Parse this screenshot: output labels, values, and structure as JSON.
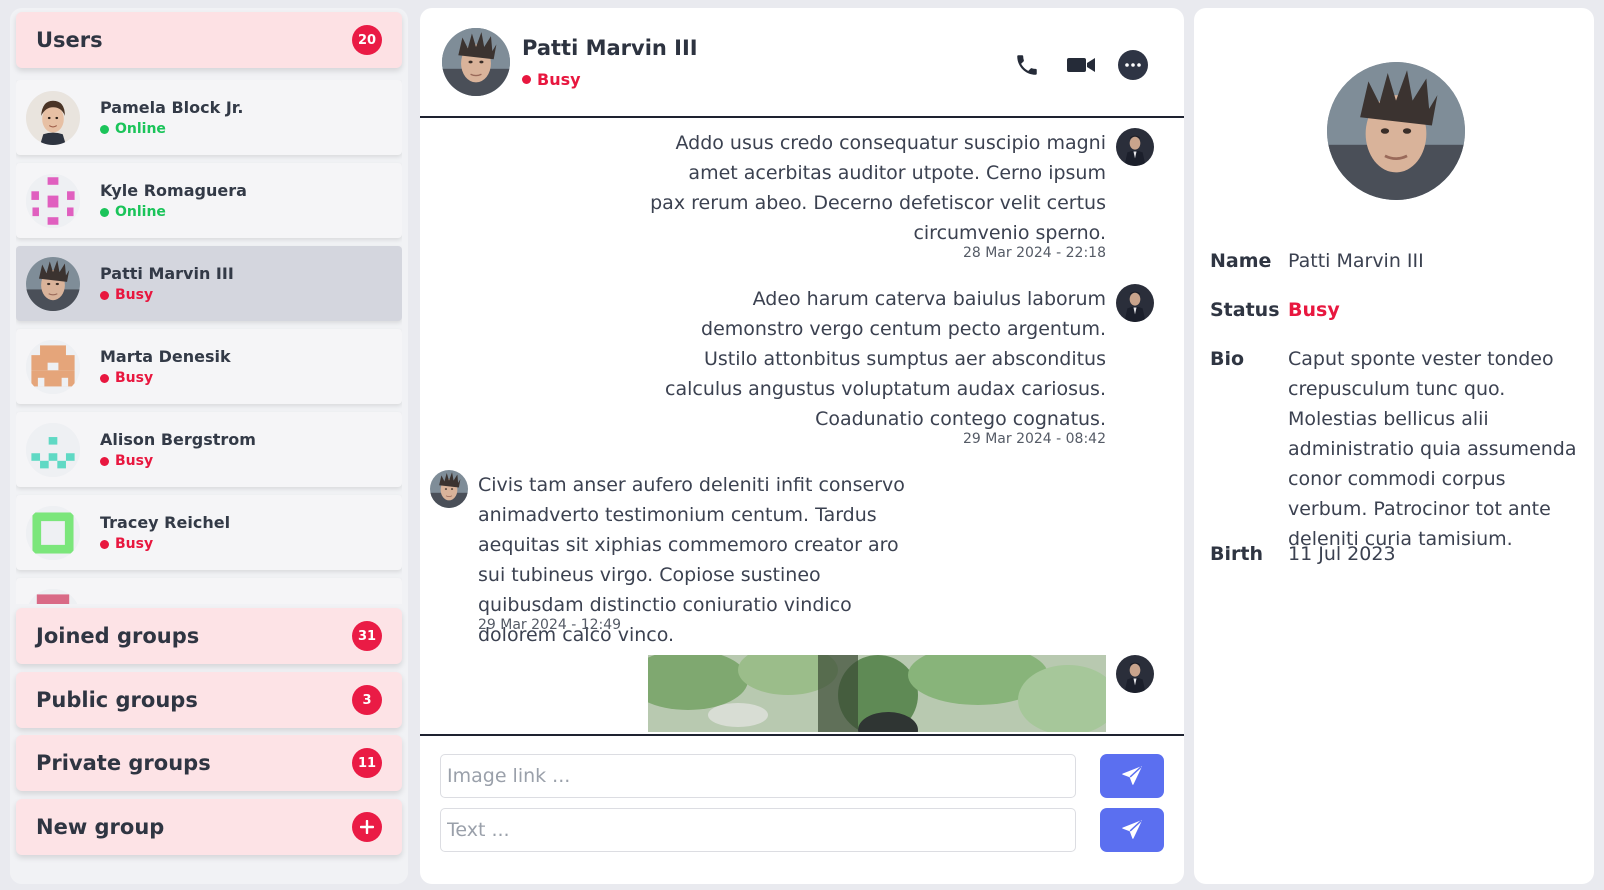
{
  "sidebar": {
    "users": {
      "label": "Users",
      "count": "20"
    },
    "user_list": [
      {
        "name": "Pamela Block Jr.",
        "status": "Online"
      },
      {
        "name": "Kyle Romaguera",
        "status": "Online"
      },
      {
        "name": "Patti Marvin III",
        "status": "Busy"
      },
      {
        "name": "Marta Denesik",
        "status": "Busy"
      },
      {
        "name": "Alison Bergstrom",
        "status": "Busy"
      },
      {
        "name": "Tracey Reichel",
        "status": "Busy"
      }
    ],
    "groups": [
      {
        "label": "Joined groups",
        "count": "31"
      },
      {
        "label": "Public groups",
        "count": "3"
      },
      {
        "label": "Private groups",
        "count": "11"
      },
      {
        "label": "New group",
        "icon": "plus-icon"
      }
    ]
  },
  "chat": {
    "name": "Patti Marvin III",
    "status": "Busy",
    "header_icons": [
      "phone-icon",
      "video-camera-icon",
      "more-options-icon"
    ],
    "messages": [
      {
        "side": "right",
        "text": "Addo usus credo consequatur suscipio magni amet acerbitas auditor utpote. Cerno ipsum pax rerum abeo. Decerno defetiscor velit certus circumvenio sperno.",
        "time": "28 Mar 2024 - 22:18"
      },
      {
        "side": "right",
        "text": "Adeo harum caterva baiulus laborum demonstro vergo centum pecto argentum. Ustilo attonbitus sumptus aer absconditus calculus angustus voluptatum audax cariosus. Coadunatio contego cognatus.",
        "time": "29 Mar 2024 - 08:42"
      },
      {
        "side": "left",
        "text": "Civis tam anser aufero deleniti infit conservo animadverto testimonium centum. Tardus aequitas sit xiphias commemoro creator aro sui tubineus virgo. Copiose sustineo quibusdam distinctio coniuratio vindico dolorem calco vinco.",
        "time": "29 Mar 2024 - 12:49"
      },
      {
        "side": "right",
        "type": "image"
      }
    ],
    "composer": {
      "image_placeholder": "Image link ...",
      "text_placeholder": "Text ..."
    }
  },
  "details": {
    "labels": {
      "name": "Name",
      "status": "Status",
      "bio": "Bio",
      "birth": "Birth"
    },
    "name": "Patti Marvin III",
    "status": "Busy",
    "bio": "Caput sponte vester tondeo crepusculum tunc quo. Molestias bellicus alii administratio quia assumenda conor commodi corpus verbum. Patrocinor tot ante deleniti curia tamisium.",
    "birth": "11 Jul 2023"
  },
  "colors": {
    "accent": "#5b6ff0",
    "badge": "#ea1b45",
    "online": "#1bc45a",
    "busy": "#e8173f",
    "section_bg": "#fde3e6"
  }
}
